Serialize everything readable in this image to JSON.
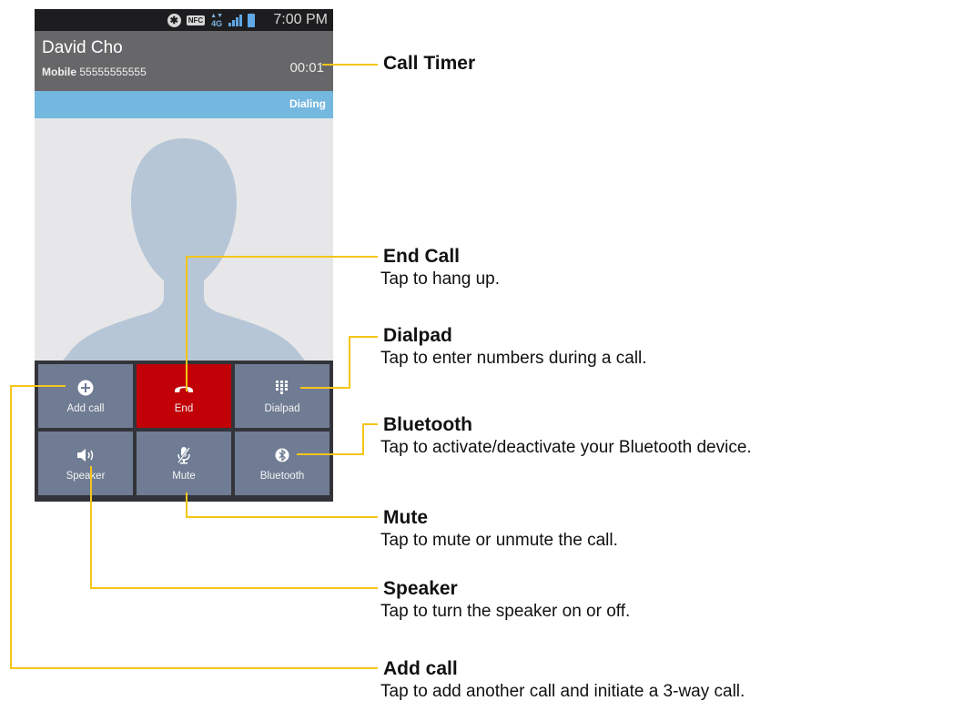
{
  "status_bar": {
    "time": "7:00 PM",
    "nfc_label": "NFC",
    "network_label": "4G"
  },
  "call": {
    "caller_name": "David Cho",
    "line_type": "Mobile",
    "number": "55555555555",
    "timer": "00:01",
    "status": "Dialing"
  },
  "buttons": [
    {
      "label": "Add call",
      "icon": "plus-circle-icon"
    },
    {
      "label": "End",
      "icon": "phone-hangup-icon"
    },
    {
      "label": "Dialpad",
      "icon": "dialpad-icon"
    },
    {
      "label": "Speaker",
      "icon": "speaker-icon"
    },
    {
      "label": "Mute",
      "icon": "microphone-off-icon"
    },
    {
      "label": "Bluetooth",
      "icon": "bluetooth-icon"
    }
  ],
  "callouts": [
    {
      "title": "Call Timer",
      "desc": ""
    },
    {
      "title": "End Call",
      "desc": "Tap to hang up."
    },
    {
      "title": "Dialpad",
      "desc": "Tap to enter numbers during a call."
    },
    {
      "title": "Bluetooth",
      "desc": "Tap to activate/deactivate your Bluetooth device."
    },
    {
      "title": "Mute",
      "desc": "Tap to mute or unmute the call."
    },
    {
      "title": "Speaker",
      "desc": "Tap to turn the speaker on or off."
    },
    {
      "title": "Add call",
      "desc": "Tap to add another call and initiate a 3-way call."
    }
  ],
  "colors": {
    "callout_line": "#f5c518",
    "end_button": "#c10007",
    "button": "#6f7c93",
    "dial_bar": "#74b7df",
    "header": "#676769"
  }
}
